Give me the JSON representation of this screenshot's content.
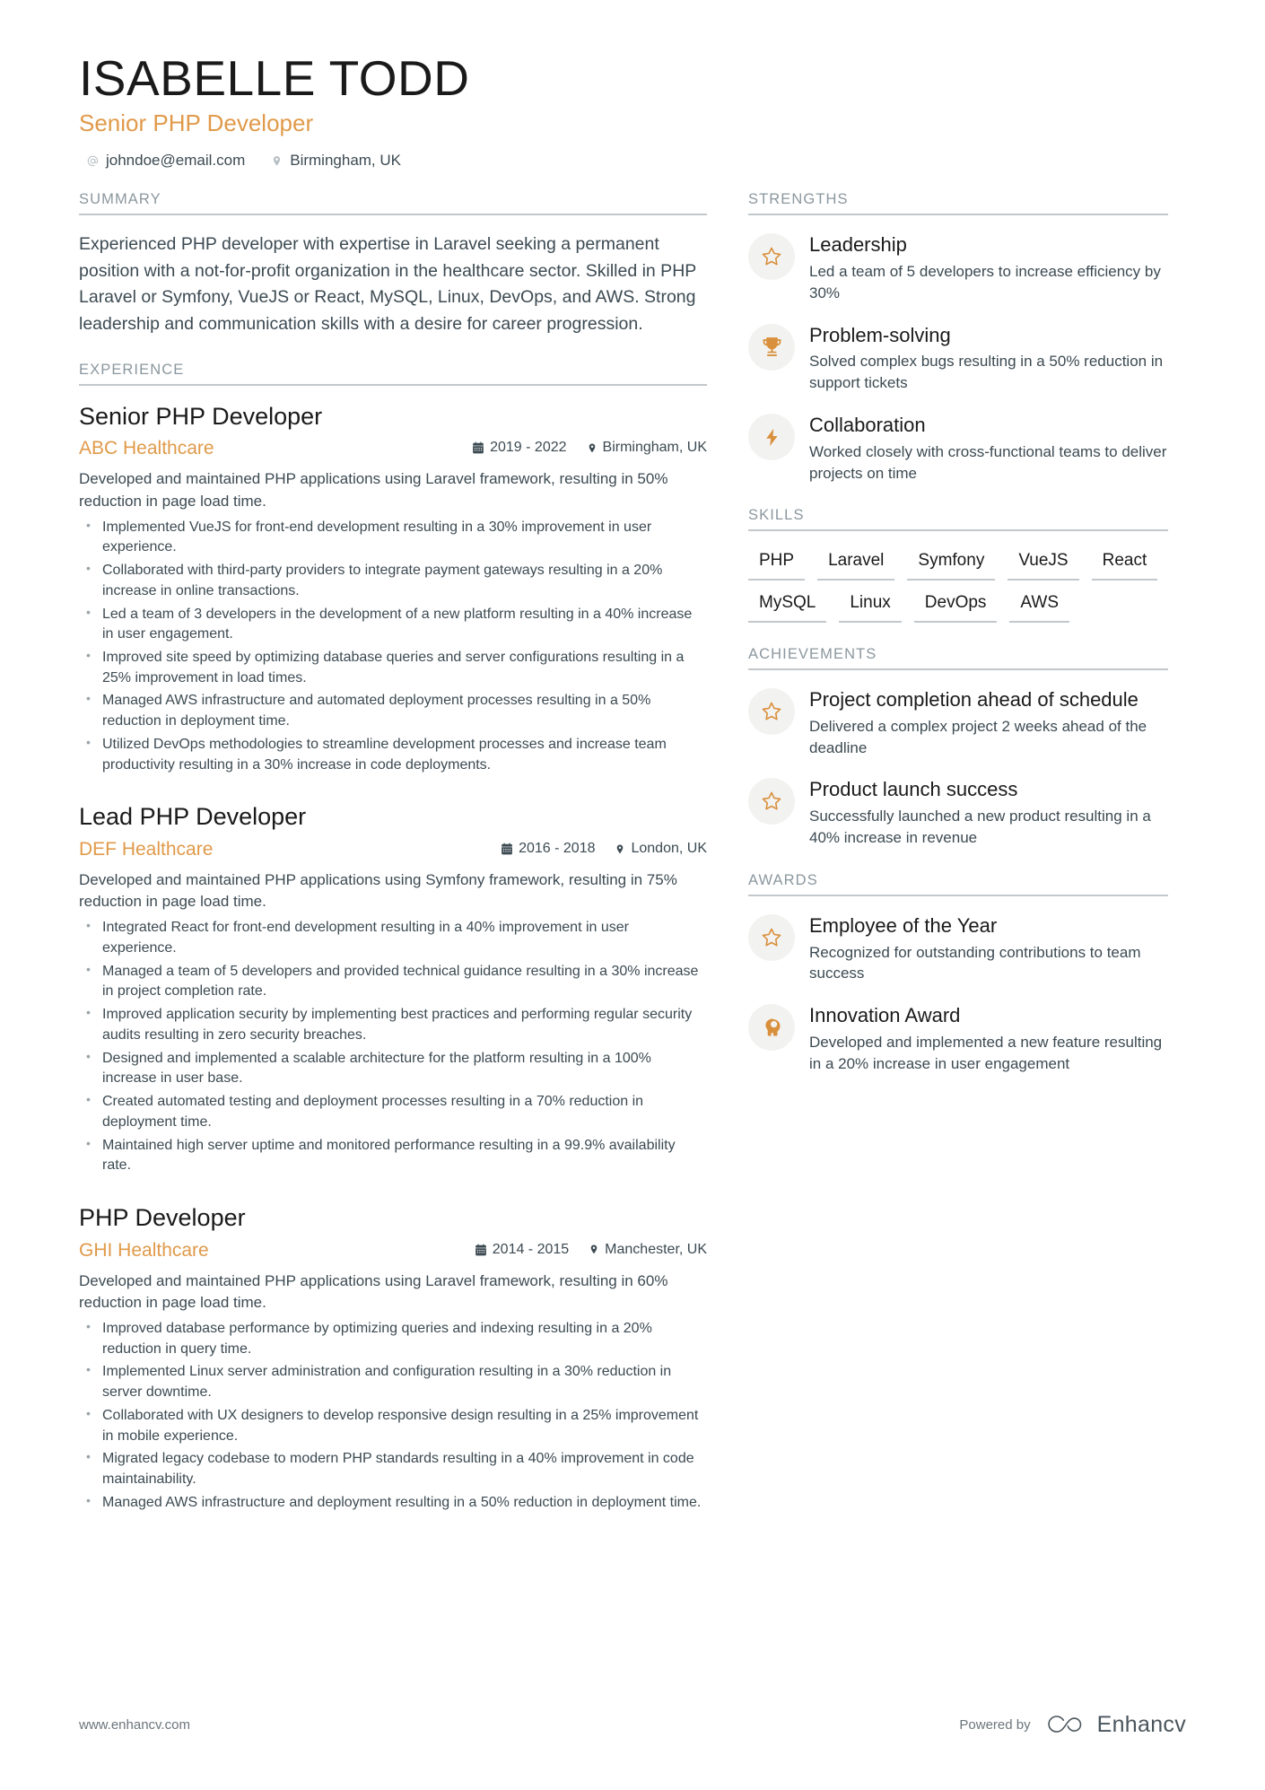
{
  "header": {
    "name": "ISABELLE TODD",
    "title": "Senior PHP Developer",
    "contacts": [
      {
        "icon": "at-icon",
        "text": "johndoe@email.com"
      },
      {
        "icon": "location-pin-icon",
        "text": "Birmingham, UK"
      }
    ]
  },
  "colors": {
    "accent": "#e09a4a",
    "icon_accent": "#d9903c",
    "text": "#3c4a52",
    "heading": "#1a1a1a",
    "section_label": "#8b979e",
    "rule": "#c2c8cc",
    "bubble_bg": "#f2f2f1"
  },
  "summary": {
    "section_label": "SUMMARY",
    "text": "Experienced PHP developer with expertise in Laravel seeking a permanent position with a not-for-profit organization in the healthcare sector. Skilled in PHP Laravel or Symfony, VueJS or React, MySQL, Linux, DevOps, and AWS. Strong leadership and communication skills with a desire for career progression."
  },
  "experience": {
    "section_label": "EXPERIENCE",
    "items": [
      {
        "role": "Senior PHP Developer",
        "company": "ABC Healthcare",
        "dates": "2019 - 2022",
        "location": "Birmingham, UK",
        "description": "Developed and maintained PHP applications using Laravel framework, resulting in 50% reduction in page load time.",
        "bullets": [
          "Implemented VueJS for front-end development resulting in a 30% improvement in user experience.",
          "Collaborated with third-party providers to integrate payment gateways resulting in a 20% increase in online transactions.",
          "Led a team of 3 developers in the development of a new platform resulting in a 40% increase in user engagement.",
          "Improved site speed by optimizing database queries and server configurations resulting in a 25% improvement in load times.",
          "Managed AWS infrastructure and automated deployment processes resulting in a 50% reduction in deployment time.",
          "Utilized DevOps methodologies to streamline development processes and increase team productivity resulting in a 30% increase in code deployments."
        ]
      },
      {
        "role": "Lead PHP Developer",
        "company": "DEF Healthcare",
        "dates": "2016 - 2018",
        "location": "London, UK",
        "description": "Developed and maintained PHP applications using Symfony framework, resulting in 75% reduction in page load time.",
        "bullets": [
          "Integrated React for front-end development resulting in a 40% improvement in user experience.",
          "Managed a team of 5 developers and provided technical guidance resulting in a 30% increase in project completion rate.",
          "Improved application security by implementing best practices and performing regular security audits resulting in zero security breaches.",
          "Designed and implemented a scalable architecture for the platform resulting in a 100% increase in user base.",
          "Created automated testing and deployment processes resulting in a 70% reduction in deployment time.",
          "Maintained high server uptime and monitored performance resulting in a 99.9% availability rate."
        ]
      },
      {
        "role": "PHP Developer",
        "company": "GHI Healthcare",
        "dates": "2014 - 2015",
        "location": "Manchester, UK",
        "description": "Developed and maintained PHP applications using Laravel framework, resulting in 60% reduction in page load time.",
        "bullets": [
          "Improved database performance by optimizing queries and indexing resulting in a 20% reduction in query time.",
          "Implemented Linux server administration and configuration resulting in a 30% reduction in server downtime.",
          "Collaborated with UX designers to develop responsive design resulting in a 25% improvement in mobile experience.",
          "Migrated legacy codebase to modern PHP standards resulting in a 40% improvement in code maintainability.",
          "Managed AWS infrastructure and deployment resulting in a 50% reduction in deployment time."
        ]
      }
    ]
  },
  "strengths": {
    "section_label": "STRENGTHS",
    "items": [
      {
        "icon": "star-icon",
        "title": "Leadership",
        "desc": "Led a team of 5 developers to increase efficiency by 30%"
      },
      {
        "icon": "trophy-icon",
        "title": "Problem-solving",
        "desc": "Solved complex bugs resulting in a 50% reduction in support tickets"
      },
      {
        "icon": "lightning-bolt-icon",
        "title": "Collaboration",
        "desc": "Worked closely with cross-functional teams to deliver projects on time"
      }
    ]
  },
  "skills": {
    "section_label": "SKILLS",
    "items": [
      "PHP",
      "Laravel",
      "Symfony",
      "VueJS",
      "React",
      "MySQL",
      "Linux",
      "DevOps",
      "AWS"
    ]
  },
  "achievements": {
    "section_label": "ACHIEVEMENTS",
    "items": [
      {
        "icon": "star-icon",
        "title": "Project completion ahead of schedule",
        "desc": "Delivered a complex project 2 weeks ahead of the deadline"
      },
      {
        "icon": "star-icon",
        "title": "Product launch success",
        "desc": "Successfully launched a new product resulting in a 40% increase in revenue"
      }
    ]
  },
  "awards": {
    "section_label": "AWARDS",
    "items": [
      {
        "icon": "star-icon",
        "title": "Employee of the Year",
        "desc": "Recognized for outstanding contributions to team success"
      },
      {
        "icon": "head-idea-icon",
        "title": "Innovation Award",
        "desc": "Developed and implemented a new feature resulting in a 20% increase in user engagement"
      }
    ]
  },
  "footer": {
    "website": "www.enhancv.com",
    "powered_by": "Powered by",
    "brand": "Enhancv"
  }
}
